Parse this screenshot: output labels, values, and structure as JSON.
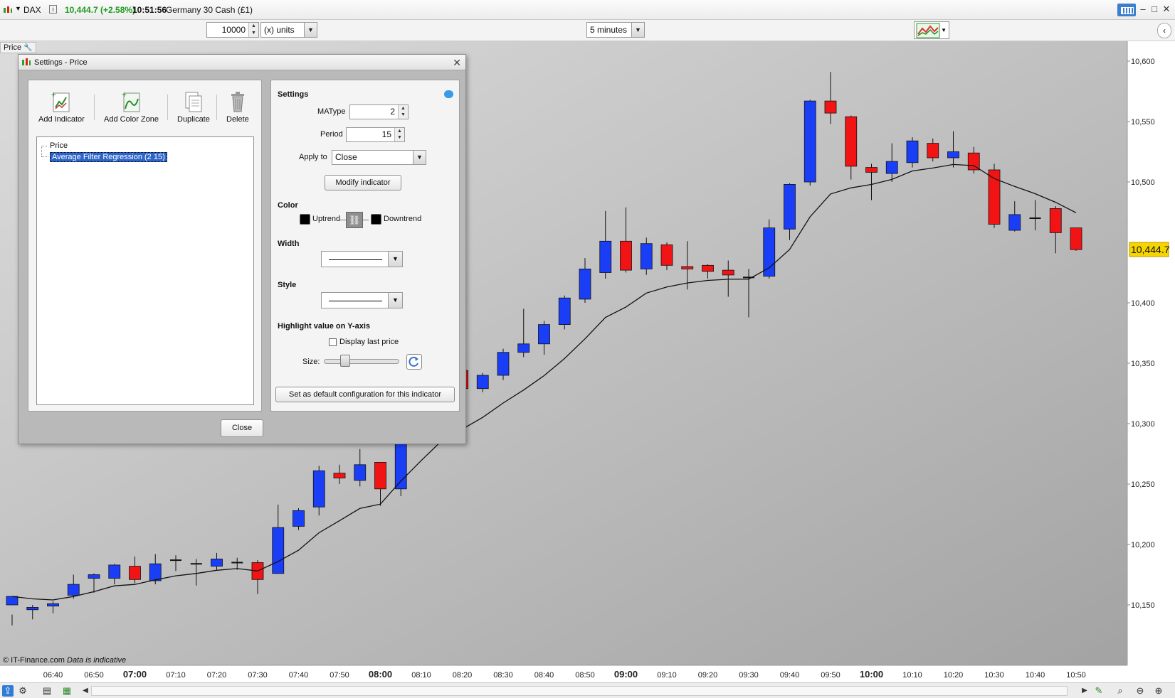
{
  "titlebar": {
    "symbol": "DAX",
    "info": "i",
    "last_price": "10,444.7 (+2.58%)",
    "time": "10:51:56",
    "instrument": "Germany 30 Cash (£1)"
  },
  "toolbar": {
    "quantity": "10000",
    "units": "(x) units",
    "timeframe": "5 minutes"
  },
  "chart": {
    "price_tab": "Price",
    "copyright": "© IT-Finance.com",
    "disclaimer": "Data is indicative",
    "price_badge": "10,444.7",
    "colors": {
      "up": "#1a3ef5",
      "down": "#f21414",
      "wick": "#111111",
      "badge": "#f5d400"
    },
    "y_labels": [
      {
        "v": 10600,
        "t": "10,600"
      },
      {
        "v": 10550,
        "t": "10,550"
      },
      {
        "v": 10500,
        "t": "10,500"
      },
      {
        "v": 10400,
        "t": "10,400"
      },
      {
        "v": 10350,
        "t": "10,350"
      },
      {
        "v": 10300,
        "t": "10,300"
      },
      {
        "v": 10250,
        "t": "10,250"
      },
      {
        "v": 10200,
        "t": "10,200"
      },
      {
        "v": 10150,
        "t": "10,150"
      }
    ],
    "x_labels": [
      {
        "i": 2,
        "t": "06:40",
        "b": false
      },
      {
        "i": 4,
        "t": "06:50",
        "b": false
      },
      {
        "i": 6,
        "t": "07:00",
        "b": true
      },
      {
        "i": 8,
        "t": "07:10",
        "b": false
      },
      {
        "i": 10,
        "t": "07:20",
        "b": false
      },
      {
        "i": 12,
        "t": "07:30",
        "b": false
      },
      {
        "i": 14,
        "t": "07:40",
        "b": false
      },
      {
        "i": 16,
        "t": "07:50",
        "b": false
      },
      {
        "i": 18,
        "t": "08:00",
        "b": true
      },
      {
        "i": 20,
        "t": "08:10",
        "b": false
      },
      {
        "i": 22,
        "t": "08:20",
        "b": false
      },
      {
        "i": 24,
        "t": "08:30",
        "b": false
      },
      {
        "i": 26,
        "t": "08:40",
        "b": false
      },
      {
        "i": 28,
        "t": "08:50",
        "b": false
      },
      {
        "i": 30,
        "t": "09:00",
        "b": true
      },
      {
        "i": 32,
        "t": "09:10",
        "b": false
      },
      {
        "i": 34,
        "t": "09:20",
        "b": false
      },
      {
        "i": 36,
        "t": "09:30",
        "b": false
      },
      {
        "i": 38,
        "t": "09:40",
        "b": false
      },
      {
        "i": 40,
        "t": "09:50",
        "b": false
      },
      {
        "i": 42,
        "t": "10:00",
        "b": true
      },
      {
        "i": 44,
        "t": "10:10",
        "b": false
      },
      {
        "i": 46,
        "t": "10:20",
        "b": false
      },
      {
        "i": 48,
        "t": "10:30",
        "b": false
      },
      {
        "i": 50,
        "t": "10:40",
        "b": false
      },
      {
        "i": 52,
        "t": "10:50",
        "b": false
      }
    ]
  },
  "dialog": {
    "title": "Settings - Price",
    "toolbar": {
      "add_indicator": "Add Indicator",
      "add_color_zone": "Add Color Zone",
      "duplicate": "Duplicate",
      "delete": "Delete"
    },
    "tree": {
      "root": "Price",
      "child": "Average Filter Regression (2 15)"
    },
    "settings": {
      "header": "Settings",
      "matype_label": "MAType",
      "matype_value": "2",
      "period_label": "Period",
      "period_value": "15",
      "apply_to_label": "Apply to",
      "apply_to_value": "Close",
      "modify_button": "Modify indicator",
      "color_header": "Color",
      "uptrend_label": "Uptrend",
      "downtrend_label": "Downtrend",
      "width_header": "Width",
      "style_header": "Style",
      "highlight_header": "Highlight value on Y-axis",
      "display_last_price": "Display last price",
      "size_label": "Size:",
      "size_value": 0.25,
      "default_button": "Set as default configuration for this indicator"
    },
    "close_button": "Close"
  }
}
